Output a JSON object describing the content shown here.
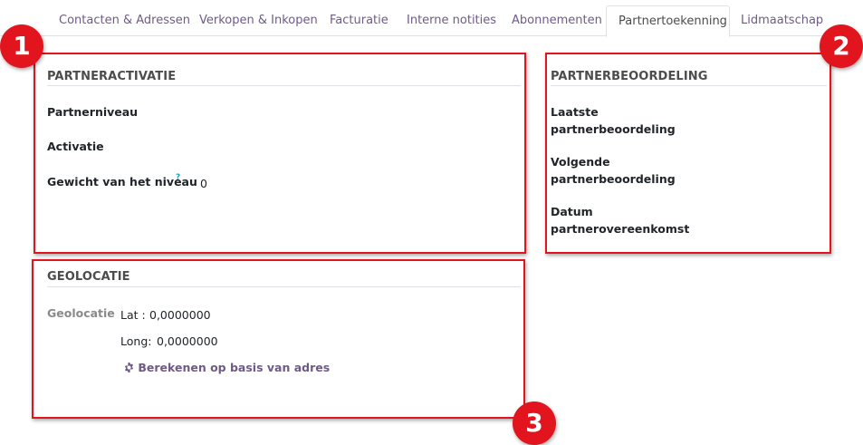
{
  "tabs": [
    {
      "label": "Contacten & Adressen",
      "active": false
    },
    {
      "label": "Verkopen & Inkopen",
      "active": false
    },
    {
      "label": "Facturatie",
      "active": false
    },
    {
      "label": "Interne notities",
      "active": false
    },
    {
      "label": "Abonnementen",
      "active": false
    },
    {
      "label": "Partnertoekenning",
      "active": true
    },
    {
      "label": "Lidmaatschap",
      "active": false
    }
  ],
  "partneractivatie": {
    "title": "PARTNERACTIVATIE",
    "partnerniveau_label": "Partnerniveau",
    "activatie_label": "Activatie",
    "gewicht_label": "Gewicht van het niveau",
    "gewicht_help": "?",
    "gewicht_value": "0"
  },
  "partnerbeoordeling": {
    "title": "PARTNERBEOORDELING",
    "laatste_label_1": "Laatste",
    "laatste_label_2": "partnerbeoordeling",
    "volgende_label_1": "Volgende",
    "volgende_label_2": "partnerbeoordeling",
    "datum_label_1": "Datum",
    "datum_label_2": "partnerovereenkomst"
  },
  "geolocatie": {
    "title": "GEOLOCATIE",
    "label": "Geolocatie",
    "lat_label": "Lat :",
    "lat_value": "0,0000000",
    "long_label": "Long:",
    "long_value": "0,0000000",
    "compute_button": "Berekenen op basis van adres",
    "compute_icon": "gear-icon"
  },
  "annotations": {
    "badge_1": "1",
    "badge_2": "2",
    "badge_3": "3",
    "color": "#e2151f"
  }
}
